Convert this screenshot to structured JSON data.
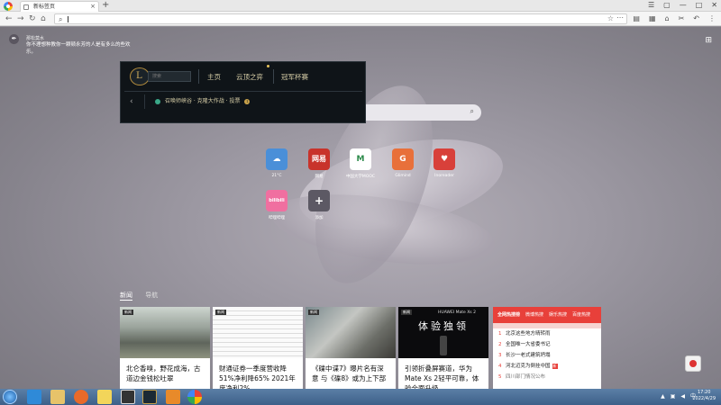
{
  "browser": {
    "tab_title": "新标签页",
    "tab_close": "×",
    "new_tab": "+",
    "window_controls": [
      "☰",
      "▢",
      "—",
      "□",
      "✕"
    ],
    "nav": {
      "back": "←",
      "forward": "→",
      "reload": "↻",
      "home": "⌂"
    },
    "url_search_icon": "⌕",
    "url_value": "",
    "star": "☆",
    "url_menu": "⋯",
    "right_tools": [
      "▤",
      "▦",
      "⌂",
      "✂",
      "↶",
      "⋮"
    ]
  },
  "quote": {
    "icon": "✒",
    "author": "那松莫水",
    "text": "你不理想种教你一颗顿永芳的人是有多么的些欢乐。"
  },
  "apps_grid_icon": "⊞",
  "overlay": {
    "search_placeholder": "搜索",
    "nav": [
      "主页",
      "云顶之弈",
      "冠军杯赛"
    ],
    "back": "‹",
    "subbar": "召唤师峡谷 · 克隆大作战 · 投票",
    "badge": "1"
  },
  "search_icon": "⌕",
  "shortcuts": [
    {
      "label": "21°C",
      "glyph": "☁",
      "color": "#4a8fd8"
    },
    {
      "label": "网易",
      "glyph": "网易",
      "color": "#c8332b"
    },
    {
      "label": "中国大学MOOC",
      "glyph": "M",
      "color": "#ffffff"
    },
    {
      "label": "Glimind",
      "glyph": "G",
      "color": "#e8703a"
    },
    {
      "label": "Inoreader",
      "glyph": "♥",
      "color": "#d8403a"
    },
    {
      "label": "哔哩哔哩",
      "glyph": "bilibili",
      "color": "#f06fa0"
    },
    {
      "label": "添加",
      "glyph": "+",
      "color": "#5c5964"
    }
  ],
  "news": {
    "tabs": [
      "新闻",
      "导航"
    ],
    "cards": [
      {
        "tag": "新闻",
        "title": "北仑香嗅，野花成海，古道边金钱松吐翠"
      },
      {
        "tag": "新闻",
        "title": "财通证券一季度营收降51%净利降65% 2021年度净利2%"
      },
      {
        "tag": "新闻",
        "title": "《碟中谍7》曝片名有深意 与《碟8》或为上下部"
      },
      {
        "tag": "新闻",
        "title": "引领折叠屏赛道，华为Mate Xs 2轻平可靠，体验全面升级"
      }
    ],
    "card4_image": {
      "brand": "HUAWEI Mate Xs 2",
      "headline": "体验独领"
    }
  },
  "hot": {
    "tabs": [
      "全网热搜榜",
      "微博热搜",
      "娱乐热搜",
      "百度热搜"
    ],
    "items": [
      {
        "rank": "1",
        "text": "北京这些地方晴转雨"
      },
      {
        "rank": "2",
        "text": "全国唯一大省委书记"
      },
      {
        "rank": "3",
        "text": "长沙一老式建筑坍塌"
      },
      {
        "rank": "4",
        "text": "河北迈克为倒挂中国",
        "flag": "新"
      },
      {
        "rank": "5",
        "text": "四川部门情况公布"
      }
    ]
  },
  "clock": {
    "time": "17:20",
    "date": "2022/4/29"
  }
}
